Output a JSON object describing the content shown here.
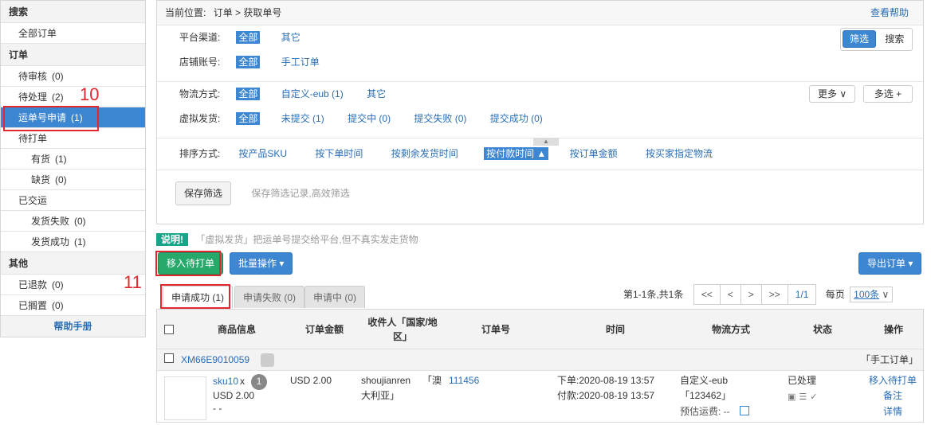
{
  "sidebar": {
    "search_head": "搜索",
    "all_orders": "全部订单",
    "order_head": "订单",
    "pending_review": {
      "label": "待审核",
      "count": "(0)"
    },
    "pending_process": {
      "label": "待处理",
      "count": "(2)"
    },
    "waybill_apply": {
      "label": "运单号申请",
      "count": "(1)"
    },
    "to_print": "待打单",
    "in_stock": {
      "label": "有货",
      "count": "(1)"
    },
    "out_stock": {
      "label": "缺货",
      "count": "(0)"
    },
    "shipped": "已交运",
    "ship_failed": {
      "label": "发货失败",
      "count": "(0)"
    },
    "ship_success": {
      "label": "发货成功",
      "count": "(1)"
    },
    "other_head": "其他",
    "refunded": {
      "label": "已退款",
      "count": "(0)"
    },
    "shelved": {
      "label": "已搁置",
      "count": "(0)"
    },
    "help": "帮助手册"
  },
  "annotations": {
    "n10": "10",
    "n11": "11"
  },
  "breadcrumb": {
    "prefix": "当前位置:",
    "path": "订单 > 获取单号",
    "help": "查看帮助"
  },
  "filters": {
    "platform_label": "平台渠道:",
    "platform_opts": [
      "全部",
      "其它"
    ],
    "shop_label": "店铺账号:",
    "shop_opts": [
      "全部",
      "手工订单"
    ],
    "filter_btn": "筛选",
    "search_btn": "搜索",
    "logistics_label": "物流方式:",
    "logistics_opts": [
      "全部",
      "自定义-eub  (1)",
      "其它"
    ],
    "more_btn": "更多",
    "multi_btn": "多选 +",
    "virtual_label": "虚拟发货:",
    "virtual_opts": [
      "全部",
      "未提交  (1)",
      "提交中  (0)",
      "提交失败  (0)",
      "提交成功  (0)"
    ],
    "sort_label": "排序方式:",
    "sort_opts": [
      "按产品SKU",
      "按下单时间",
      "按剩余发货时间",
      "按付款时间 ▲",
      "按订单金额",
      "按买家指定物流"
    ],
    "save_btn": "保存筛选",
    "save_hint": "保存筛选记录,高效筛选"
  },
  "notice": {
    "tag": "说明!",
    "text": "「虚拟发货」把运单号提交给平台,但不真实发走货物"
  },
  "actions": {
    "move": "移入待打单",
    "batch": "批量操作 ▾",
    "export": "导出订单 ▾"
  },
  "tabs": [
    "申请成功 (1)",
    "申请失败 (0)",
    "申请中 (0)"
  ],
  "pager": {
    "summary": "第1-1条,共1条",
    "first": "<<",
    "prev": "<",
    "next": ">",
    "last": ">>",
    "page": "1/1",
    "per_page_label": "每页",
    "per_page": "100条"
  },
  "table": {
    "headers": [
      "商品信息",
      "订单金额",
      "收件人「国家/地区」",
      "订单号",
      "时间",
      "物流方式",
      "状态",
      "操作"
    ],
    "group": {
      "order_id": "XM66E9010059",
      "source": "「手工订单」"
    },
    "row": {
      "sku": "sku10",
      "qty_x": "x",
      "qty": "1",
      "price": "USD 2.00",
      "dash": "- -",
      "amount": "USD 2.00",
      "recipient": "shoujianren",
      "country": "「澳大利亚」",
      "order_no": "111456",
      "order_time": "下单:2020-08-19 13:57",
      "pay_time": "付款:2020-08-19 13:57",
      "logistics": "自定义-eub",
      "tracking": "「123462」",
      "est_fee": "预估运费: --",
      "status": "已处理",
      "op_move": "移入待打单",
      "op_note": "备注",
      "op_detail": "详情"
    }
  }
}
